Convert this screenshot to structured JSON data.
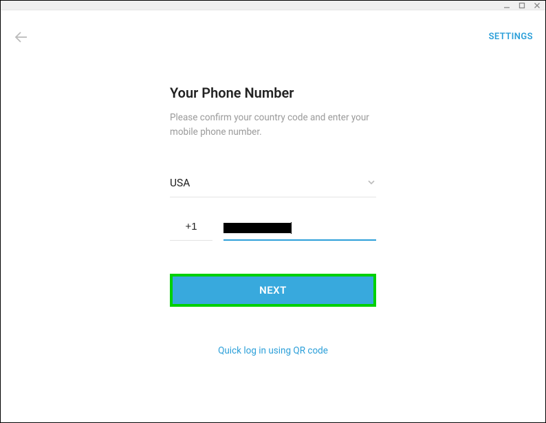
{
  "header": {
    "settings_label": "SETTINGS"
  },
  "form": {
    "title": "Your Phone Number",
    "subtitle": "Please confirm your country code and enter your mobile phone number.",
    "country": "USA",
    "country_code": "+1",
    "next_label": "NEXT",
    "qr_label": "Quick log in using QR code"
  }
}
